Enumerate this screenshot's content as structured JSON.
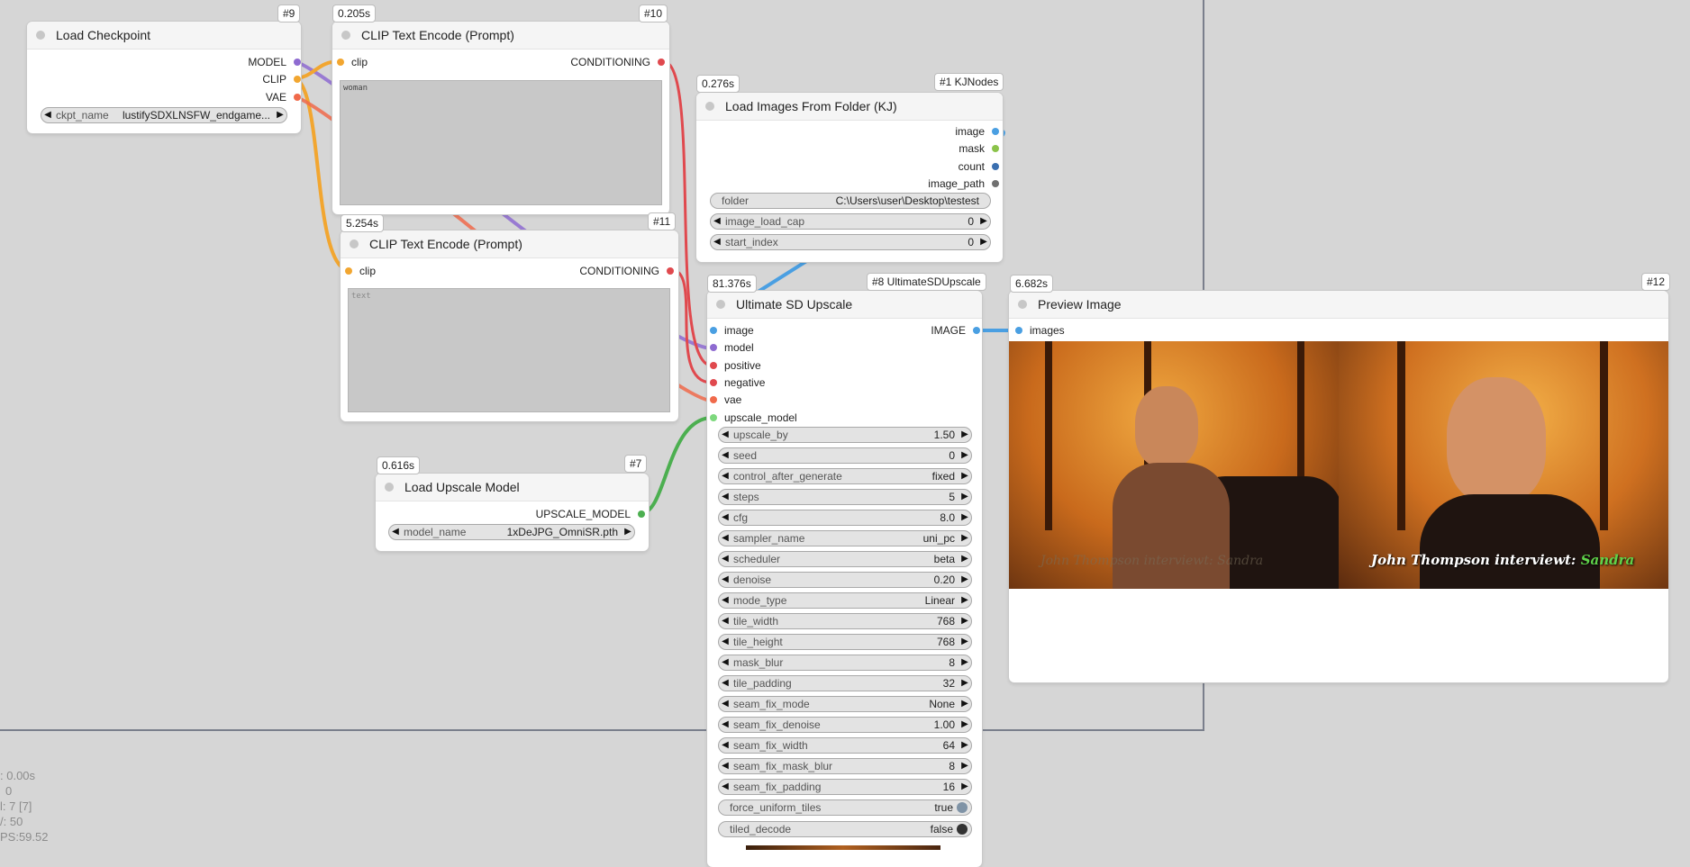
{
  "colors": {
    "canvas": "#d6d6d6",
    "model": "#8e6bd1",
    "clip": "#f2a630",
    "vae": "#f06a4b",
    "conditioning": "#e0494e",
    "image": "#4a9fe2",
    "mask": "#8bc34a",
    "count": "#3a6fb0",
    "upscale_model": "#4caf50"
  },
  "nodes": {
    "load_checkpoint": {
      "title": "Load Checkpoint",
      "id": "#9",
      "outputs": [
        "MODEL",
        "CLIP",
        "VAE"
      ],
      "widget": {
        "name": "ckpt_name",
        "value": "lustifySDXLNSFW_endgame..."
      }
    },
    "clip_text_encode_1": {
      "title": "CLIP Text Encode (Prompt)",
      "id": "#10",
      "time": "0.205s",
      "input": "clip",
      "output": "CONDITIONING",
      "text": "woman"
    },
    "clip_text_encode_2": {
      "title": "CLIP Text Encode (Prompt)",
      "id": "#11",
      "time": "5.254s",
      "input": "clip",
      "output": "CONDITIONING",
      "placeholder": "text"
    },
    "load_images_folder": {
      "title": "Load Images From Folder (KJ)",
      "id": "#1 KJNodes",
      "time": "0.276s",
      "outputs": [
        "image",
        "mask",
        "count",
        "image_path"
      ],
      "widgets": [
        {
          "name": "folder",
          "value": "C:\\Users\\user\\Desktop\\testest"
        },
        {
          "name": "image_load_cap",
          "value": "0"
        },
        {
          "name": "start_index",
          "value": "0"
        }
      ]
    },
    "load_upscale_model": {
      "title": "Load Upscale Model",
      "id": "#7",
      "time": "0.616s",
      "output": "UPSCALE_MODEL",
      "widget": {
        "name": "model_name",
        "value": "1xDeJPG_OmniSR.pth"
      }
    },
    "ultimate_sd_upscale": {
      "title": "Ultimate SD Upscale",
      "id": "#8 UltimateSDUpscale",
      "time": "81.376s",
      "inputs": [
        "image",
        "model",
        "positive",
        "negative",
        "vae",
        "upscale_model"
      ],
      "output": "IMAGE",
      "widgets": [
        {
          "name": "upscale_by",
          "value": "1.50"
        },
        {
          "name": "seed",
          "value": "0"
        },
        {
          "name": "control_after_generate",
          "value": "fixed"
        },
        {
          "name": "steps",
          "value": "5"
        },
        {
          "name": "cfg",
          "value": "8.0"
        },
        {
          "name": "sampler_name",
          "value": "uni_pc"
        },
        {
          "name": "scheduler",
          "value": "beta"
        },
        {
          "name": "denoise",
          "value": "0.20"
        },
        {
          "name": "mode_type",
          "value": "Linear"
        },
        {
          "name": "tile_width",
          "value": "768"
        },
        {
          "name": "tile_height",
          "value": "768"
        },
        {
          "name": "mask_blur",
          "value": "8"
        },
        {
          "name": "tile_padding",
          "value": "32"
        },
        {
          "name": "seam_fix_mode",
          "value": "None"
        },
        {
          "name": "seam_fix_denoise",
          "value": "1.00"
        },
        {
          "name": "seam_fix_width",
          "value": "64"
        },
        {
          "name": "seam_fix_mask_blur",
          "value": "8"
        },
        {
          "name": "seam_fix_padding",
          "value": "16"
        }
      ],
      "toggles": [
        {
          "name": "force_uniform_tiles",
          "value": "true"
        },
        {
          "name": "tiled_decode",
          "value": "false"
        }
      ]
    },
    "preview_image": {
      "title": "Preview Image",
      "id": "#12",
      "time": "6.682s",
      "input": "images",
      "caption_left": "John Thompson interviewt: Sandra",
      "caption_right_prefix": "John Thompson interviewt: ",
      "caption_right_name": "Sandra"
    }
  },
  "stats": {
    "line1": ": 0.00s",
    "line2": "0",
    "line3": "l: 7 [7]",
    "line4": "/: 50",
    "line5": "PS:59.52"
  }
}
